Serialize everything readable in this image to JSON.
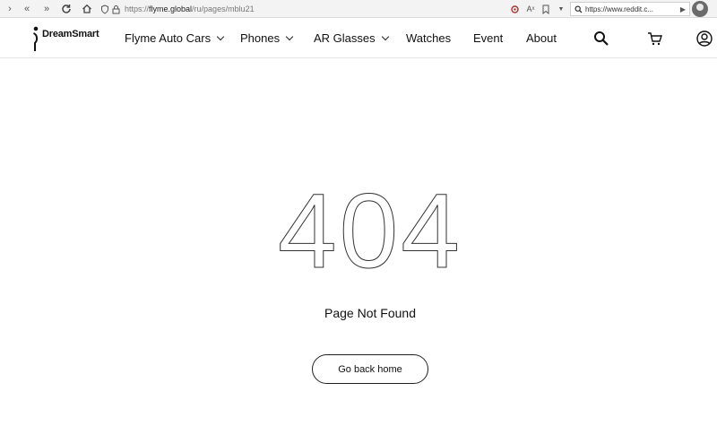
{
  "browser": {
    "url_protocol": "https://",
    "url_host": "flyme.global",
    "url_path": "/ru/pages/mblu21",
    "search_text": "https://www.reddit.c..."
  },
  "header": {
    "logo_text": "DreamSmart",
    "nav": [
      {
        "label": "Flyme Auto Cars",
        "dropdown": true
      },
      {
        "label": "Phones",
        "dropdown": true
      },
      {
        "label": "AR Glasses",
        "dropdown": true
      },
      {
        "label": "Watches",
        "dropdown": false
      },
      {
        "label": "Event",
        "dropdown": false
      },
      {
        "label": "About",
        "dropdown": false
      }
    ]
  },
  "main": {
    "error_code": "404",
    "message": "Page Not Found",
    "button_label": "Go back home"
  }
}
